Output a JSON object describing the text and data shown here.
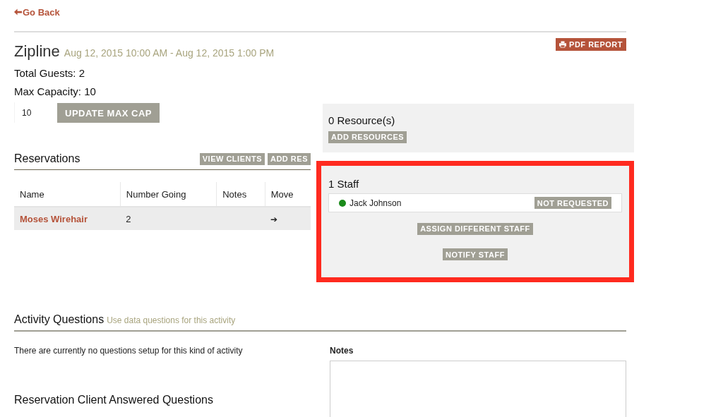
{
  "back_link": "Go Back",
  "activity": {
    "title": "Zipline",
    "time": "Aug 12, 2015 10:00 AM - Aug 12, 2015 1:00 PM",
    "pdf_button": "PDF REPORT"
  },
  "total_guests": "Total Guests: 2",
  "max_capacity": "Max Capacity: 10",
  "max_cap_field": {
    "value": "10",
    "button": "UPDATE MAX CAP"
  },
  "reservations": {
    "title": "Reservations",
    "buttons": [
      "VIEW CLIENTS",
      "ADD RES"
    ],
    "columns": [
      "Name",
      "Number Going",
      "Notes",
      "Move"
    ],
    "rows": [
      {
        "name": "Moses Wirehair",
        "number_going": "2",
        "notes": "",
        "move": "➔"
      }
    ]
  },
  "resources": {
    "title": "0 Resource(s)",
    "button": "ADD RESOURCES"
  },
  "staff": {
    "title": "1 Staff",
    "highlighted": true,
    "members": [
      {
        "name": "Jack Johnson",
        "color": "#1a8a1a",
        "status": "NOT REQUESTED"
      }
    ],
    "buttons": [
      "ASSIGN DIFFERENT STAFF",
      "NOTIFY STAFF"
    ]
  },
  "activity_questions": {
    "title": "Activity Questions",
    "subtitle": "Use data questions for this activity",
    "empty_text": "There are currently no questions setup for this kind of activity"
  },
  "notes": {
    "label": "Notes"
  },
  "client_questions": {
    "title": "Reservation Client Answered Questions"
  }
}
